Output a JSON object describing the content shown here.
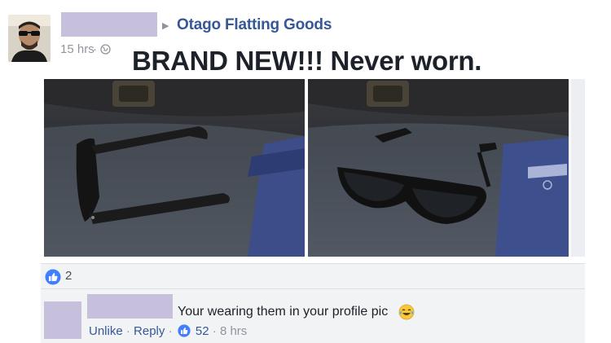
{
  "post": {
    "group_name": "Otago Flatting Goods",
    "time": "15 hrs",
    "separator": "·",
    "text": "BRAND NEW!!! Never worn."
  },
  "icons": {
    "arrow": "triangle-right-icon",
    "privacy": "globe-icon",
    "like": "thumbs-up-icon",
    "emoji": "laughing-tears-emoji-icon"
  },
  "reactions": {
    "like_count": "2"
  },
  "comment": {
    "text": "Your wearing them in your profile pic",
    "actions": {
      "unlike": "Unlike",
      "reply": "Reply",
      "separator": "·",
      "likes": "52",
      "time": "8 hrs"
    }
  },
  "colors": {
    "link_blue": "#365899",
    "meta_gray": "#90949c",
    "redaction": "#c6c0dd",
    "like_blue": "#4080ff",
    "comment_bg": "#f2f3f5"
  }
}
